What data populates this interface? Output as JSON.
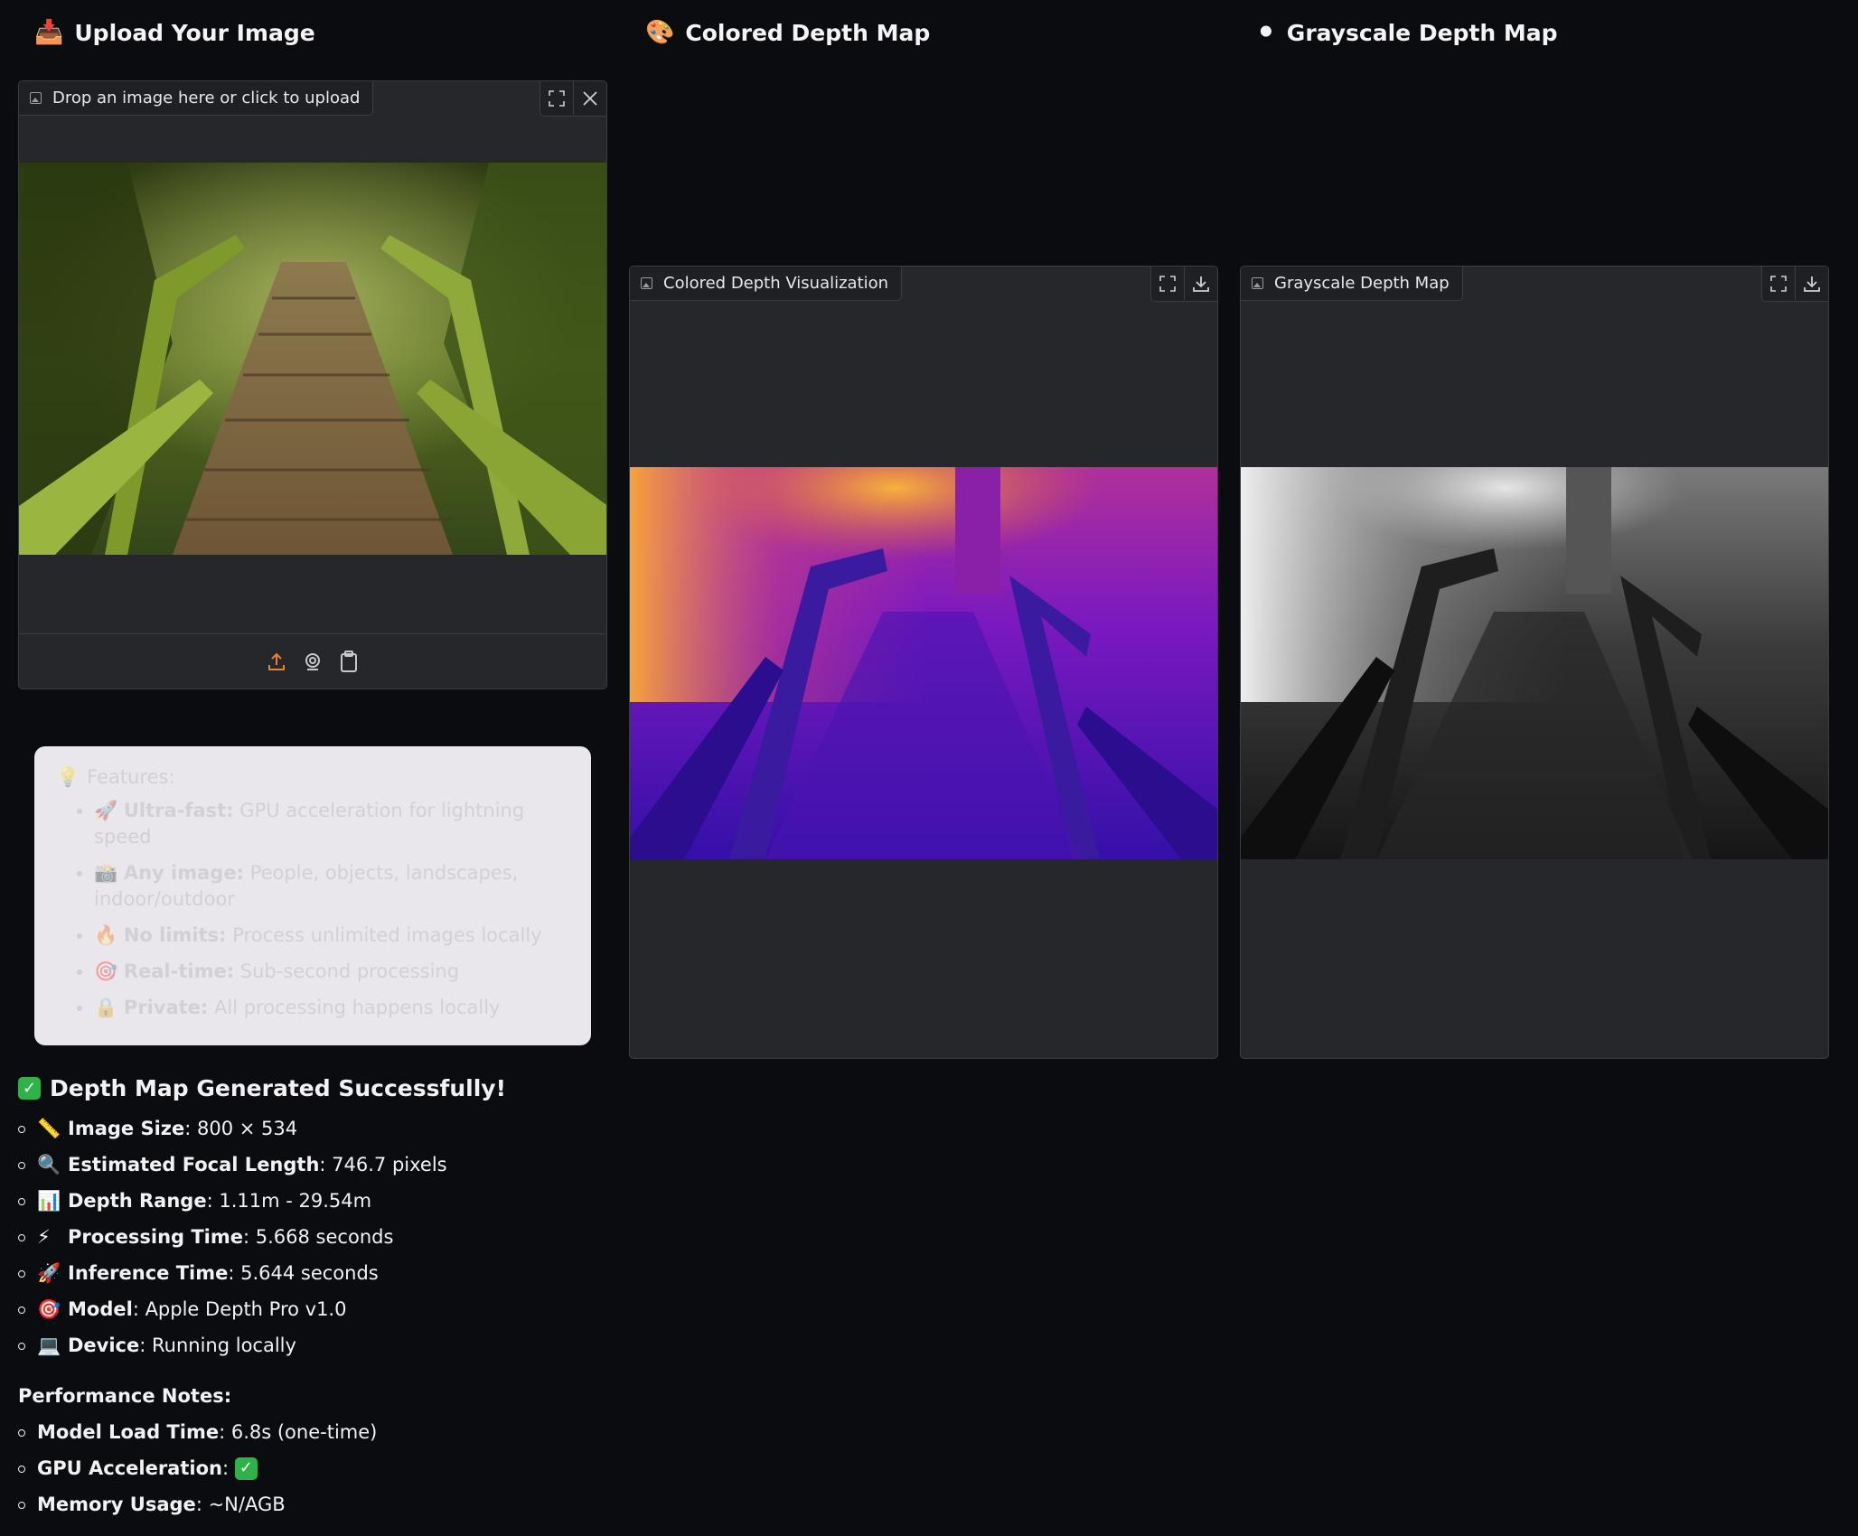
{
  "columns": {
    "upload_title": "Upload Your Image",
    "colored_title": "Colored Depth Map",
    "grayscale_title": "Grayscale Depth Map"
  },
  "upload_panel": {
    "label": "Drop an image here or click to upload",
    "icons": [
      "fullscreen-icon",
      "close-icon",
      "upload-icon",
      "webcam-icon",
      "clipboard-icon"
    ]
  },
  "colored_panel": {
    "label": "Colored Depth Visualization",
    "icons": [
      "fullscreen-icon",
      "download-icon"
    ]
  },
  "grayscale_panel": {
    "label": "Grayscale Depth Map",
    "icons": [
      "fullscreen-icon",
      "download-icon"
    ]
  },
  "features": {
    "title": "Features:",
    "items": [
      {
        "key": "Ultra-fast:",
        "value": "GPU acceleration for lightning speed"
      },
      {
        "key": "Any image:",
        "value": "People, objects, landscapes, indoor/outdoor"
      },
      {
        "key": "No limits:",
        "value": "Process unlimited images locally"
      },
      {
        "key": "Real-time:",
        "value": "Sub-second processing"
      },
      {
        "key": "Private:",
        "value": "All processing happens locally"
      }
    ]
  },
  "results": {
    "heading": "Depth Map Generated Successfully!",
    "items": [
      {
        "key": "Image Size",
        "value": ": 800 × 534"
      },
      {
        "key": "Estimated Focal Length",
        "value": ": 746.7 pixels"
      },
      {
        "key": "Depth Range",
        "value": ": 1.11m - 29.54m"
      },
      {
        "key": "Processing Time",
        "value": ": 5.668 seconds"
      },
      {
        "key": "Inference Time",
        "value": ": 5.644 seconds"
      },
      {
        "key": "Model",
        "value": ": Apple Depth Pro v1.0"
      },
      {
        "key": "Device",
        "value": ": Running locally"
      }
    ],
    "perf_title": "Performance Notes:",
    "perf": [
      {
        "key": "Model Load Time",
        "value": ": 6.8s (one-time)"
      },
      {
        "key": "GPU Acceleration",
        "value": ": "
      },
      {
        "key": "Memory Usage",
        "value": ": ~N/AGB"
      }
    ]
  },
  "colors": {
    "background": "#0b0c0f",
    "panel": "#26272b",
    "accent_orange": "#e8832a",
    "success_green": "#2fb24a"
  }
}
